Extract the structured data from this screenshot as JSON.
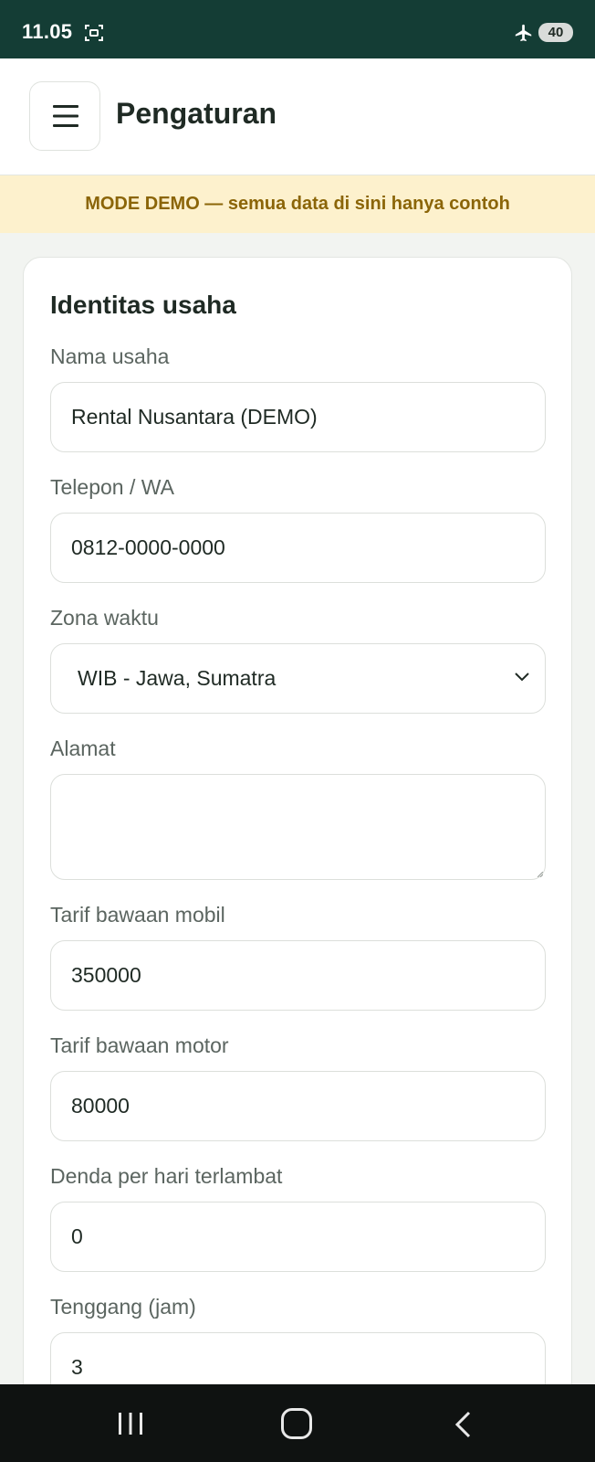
{
  "status_bar": {
    "time": "11.05",
    "battery": "40"
  },
  "header": {
    "title": "Pengaturan"
  },
  "banner": {
    "text": "MODE DEMO — semua data di sini hanya contoh"
  },
  "form": {
    "section_title": "Identitas usaha",
    "business_name": {
      "label": "Nama usaha",
      "value": "Rental Nusantara (DEMO)"
    },
    "phone": {
      "label": "Telepon / WA",
      "value": "0812-0000-0000"
    },
    "timezone": {
      "label": "Zona waktu",
      "value": "WIB - Jawa, Sumatra"
    },
    "address": {
      "label": "Alamat",
      "value": ""
    },
    "car_rate": {
      "label": "Tarif bawaan mobil",
      "value": "350000"
    },
    "motor_rate": {
      "label": "Tarif bawaan motor",
      "value": "80000"
    },
    "late_fee": {
      "label": "Denda per hari terlambat",
      "value": "0"
    },
    "grace_period": {
      "label": "Tenggang (jam)",
      "value": "3"
    }
  },
  "icons": {
    "menu": "hamburger-icon",
    "screen_record": "screen-record-icon",
    "airplane": "airplane-mode-icon",
    "select": "chevron-down-icon",
    "nav_recent": "recent-apps-icon",
    "nav_home": "home-icon",
    "nav_back": "back-icon"
  },
  "colors": {
    "status_bar": "#143d35",
    "banner_bg": "#fdf1cd",
    "banner_text": "#8b6508"
  }
}
